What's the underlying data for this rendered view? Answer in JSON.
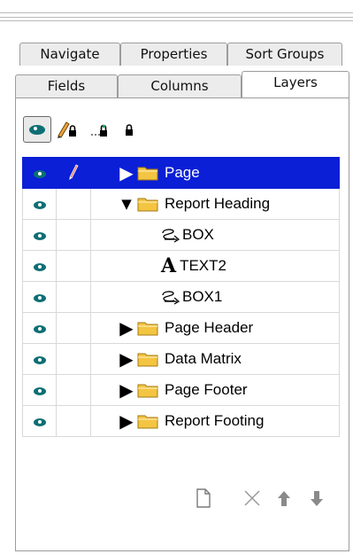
{
  "tabs_row_back": [
    {
      "label": "Navigate"
    },
    {
      "label": "Properties"
    },
    {
      "label": "Sort Groups"
    }
  ],
  "tabs_row_front": [
    {
      "label": "Fields"
    },
    {
      "label": "Columns"
    },
    {
      "label": "Layers"
    }
  ],
  "active_tab": "Layers",
  "toolbar": {
    "buttons": [
      {
        "icon": "eye-icon"
      },
      {
        "icon": "pencil-lock-icon"
      },
      {
        "icon": "move-lock-icon"
      },
      {
        "icon": "lock-icon"
      }
    ]
  },
  "layers": [
    {
      "label": "Page",
      "indent": 0,
      "icon": "folder-icon",
      "expander": "expand-right",
      "selected": true
    },
    {
      "label": "Report Heading",
      "indent": 0,
      "icon": "folder-icon",
      "expander": "expand-down"
    },
    {
      "label": "BOX",
      "indent": 1,
      "icon": "box-icon"
    },
    {
      "label": "TEXT2",
      "indent": 1,
      "icon": "text-icon"
    },
    {
      "label": "BOX1",
      "indent": 1,
      "icon": "box-icon"
    },
    {
      "label": "Page Header",
      "indent": 0,
      "icon": "folder-icon",
      "expander": "expand-right"
    },
    {
      "label": "Data Matrix",
      "indent": 0,
      "icon": "folder-icon",
      "expander": "expand-right"
    },
    {
      "label": "Page Footer",
      "indent": 0,
      "icon": "folder-icon",
      "expander": "expand-right"
    },
    {
      "label": "Report Footing",
      "indent": 0,
      "icon": "folder-icon",
      "expander": "expand-right"
    }
  ],
  "bottom_toolbar": {
    "buttons": [
      {
        "icon": "new-document-icon"
      },
      {
        "icon": "delete-icon"
      },
      {
        "icon": "move-up-icon"
      },
      {
        "icon": "move-down-icon"
      }
    ]
  },
  "colors": {
    "selection": "#0a1fd6",
    "eye": "#0c6f74",
    "folder": "#f4c542"
  }
}
